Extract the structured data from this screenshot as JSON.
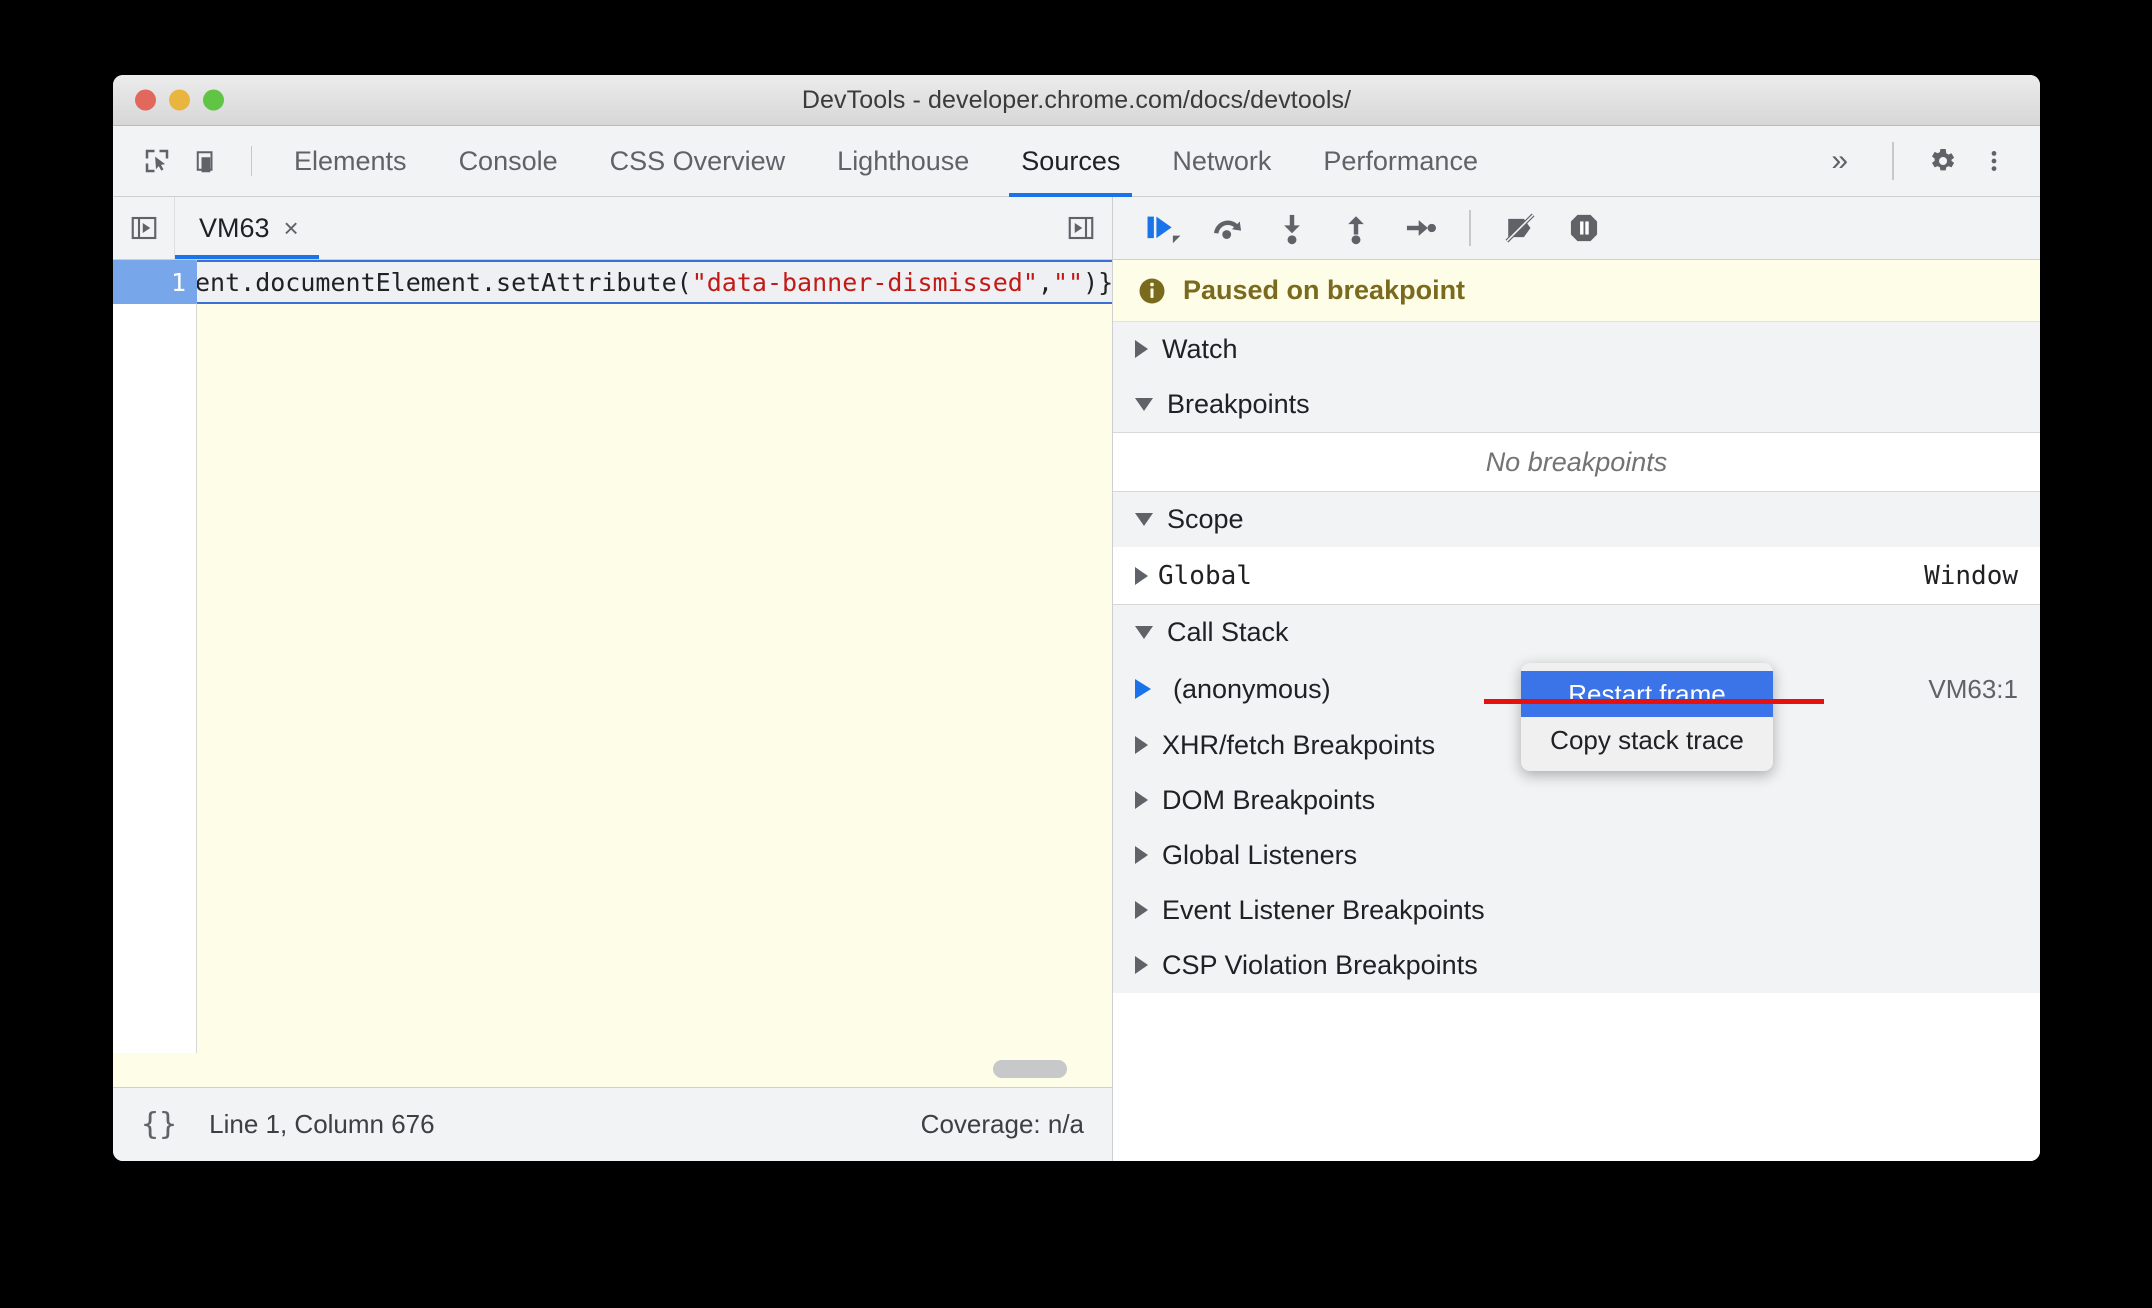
{
  "window": {
    "title": "DevTools - developer.chrome.com/docs/devtools/",
    "traffic": {
      "close": "close-button",
      "minimize": "minimize-button",
      "zoom": "zoom-button"
    }
  },
  "toolbar": {
    "inspect_icon": "inspect-element-icon",
    "device_icon": "device-toolbar-icon",
    "tabs": [
      {
        "label": "Elements",
        "active": false
      },
      {
        "label": "Console",
        "active": false
      },
      {
        "label": "CSS Overview",
        "active": false
      },
      {
        "label": "Lighthouse",
        "active": false
      },
      {
        "label": "Sources",
        "active": true
      },
      {
        "label": "Network",
        "active": false
      },
      {
        "label": "Performance",
        "active": false
      }
    ],
    "more_tabs": "»",
    "settings_icon": "gear-icon",
    "menu_icon": "kebab-menu-icon",
    "accent": "#1a73e8"
  },
  "filebar": {
    "navigator_toggle_icon": "show-navigator-icon",
    "tab_label": "VM63",
    "close_glyph": "×",
    "debugger_toggle_icon": "show-debugger-icon"
  },
  "editor": {
    "line_number": "1",
    "code_prefix": "ent.documentElement.setAttribute(",
    "code_string1": "\"data-banner-dismissed\"",
    "code_comma": ",",
    "code_string2": "\"\"",
    "code_suffix": ")}"
  },
  "statusbar": {
    "pretty_print_glyph": "{}",
    "position": "Line 1, Column 676",
    "coverage": "Coverage: n/a"
  },
  "debugbar": {
    "buttons": [
      {
        "name": "resume-script-execution",
        "label": "Resume"
      },
      {
        "name": "step-over-next-function-call",
        "label": "Step over"
      },
      {
        "name": "step-into-next-function-call",
        "label": "Step into"
      },
      {
        "name": "step-out-of-current-function",
        "label": "Step out"
      },
      {
        "name": "step",
        "label": "Step"
      },
      {
        "name": "deactivate-breakpoints",
        "label": "Deactivate breakpoints"
      },
      {
        "name": "pause-on-exceptions",
        "label": "Pause on exceptions"
      }
    ]
  },
  "paused_banner": {
    "icon": "info-icon",
    "text": "Paused on breakpoint",
    "bg": "#fdfde8",
    "fg": "#7a6a1e"
  },
  "sidebar": {
    "sections": [
      {
        "name": "watch",
        "label": "Watch",
        "expanded": false
      },
      {
        "name": "breakpoints",
        "label": "Breakpoints",
        "expanded": true
      },
      {
        "name": "scope",
        "label": "Scope",
        "expanded": true
      },
      {
        "name": "call-stack",
        "label": "Call Stack",
        "expanded": true
      },
      {
        "name": "xhr-fetch-breakpoints",
        "label": "XHR/fetch Breakpoints",
        "expanded": false
      },
      {
        "name": "dom-breakpoints",
        "label": "DOM Breakpoints",
        "expanded": false
      },
      {
        "name": "global-listeners",
        "label": "Global Listeners",
        "expanded": false
      },
      {
        "name": "event-listener-breakpoints",
        "label": "Event Listener Breakpoints",
        "expanded": false
      },
      {
        "name": "csp-violation-breakpoints",
        "label": "CSP Violation Breakpoints",
        "expanded": false
      }
    ],
    "breakpoints_empty": "No breakpoints",
    "scope": {
      "name": "Global",
      "value": "Window"
    },
    "call_stack": {
      "frame": "(anonymous)",
      "location": "VM63:1"
    }
  },
  "context_menu": {
    "items": [
      {
        "label": "Restart frame",
        "highlighted": true
      },
      {
        "label": "Copy stack trace",
        "highlighted": false
      }
    ],
    "highlight_color": "#3b73e8",
    "strikethrough_color": "#e8100f"
  }
}
